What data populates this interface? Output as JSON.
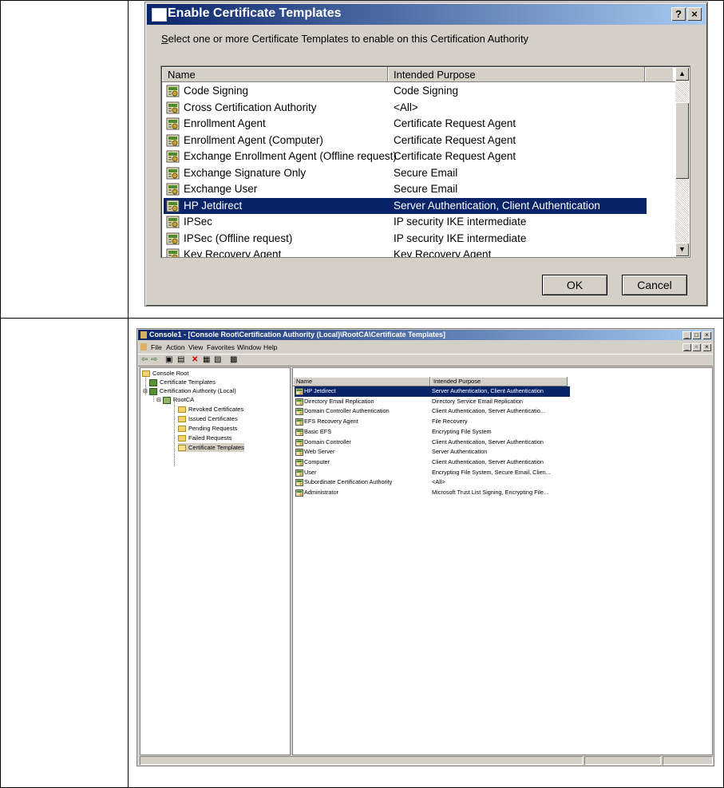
{
  "dialog": {
    "title": "Enable Certificate Templates",
    "help_button": "?",
    "close_button": "×",
    "instruction_ul": "S",
    "instruction_rest": "elect one or more Certificate Templates to enable on this Certification Authority",
    "columns": [
      "Name",
      "Intended Purpose"
    ],
    "rows": [
      {
        "name": "Code Signing",
        "purpose": "Code Signing"
      },
      {
        "name": "Cross Certification Authority",
        "purpose": "<All>"
      },
      {
        "name": "Enrollment Agent",
        "purpose": "Certificate Request Agent"
      },
      {
        "name": "Enrollment Agent (Computer)",
        "purpose": "Certificate Request Agent"
      },
      {
        "name": "Exchange Enrollment Agent (Offline request)",
        "purpose": "Certificate Request Agent"
      },
      {
        "name": "Exchange Signature Only",
        "purpose": "Secure Email"
      },
      {
        "name": "Exchange User",
        "purpose": "Secure Email"
      },
      {
        "name": "HP Jetdirect",
        "purpose": "Server Authentication, Client Authentication"
      },
      {
        "name": "IPSec",
        "purpose": "IP security IKE intermediate"
      },
      {
        "name": "IPSec (Offline request)",
        "purpose": "IP security IKE intermediate"
      },
      {
        "name": "Key Recovery Agent",
        "purpose": "Key Recovery Agent"
      }
    ],
    "selected_row": "HP Jetdirect",
    "ok_label": "OK",
    "cancel_label": "Cancel"
  },
  "console": {
    "title": "Console1 - [Console Root\\Certification Authority (Local)\\RootCA\\Certificate Templates]",
    "menu": [
      "File",
      "Action",
      "View",
      "Favorites",
      "Window",
      "Help"
    ],
    "tree": {
      "root": "Console Root",
      "templates": "Certificate Templates",
      "ca": "Certification Authority (Local)",
      "rootca": "RootCA",
      "revoked": "Revoked Certificates",
      "issued": "Issued Certificates",
      "pending": "Pending Requests",
      "failed": "Failed Requests",
      "cert_templates": "Certificate Templates"
    },
    "columns": [
      "Name",
      "Intended Purpose"
    ],
    "rows": [
      {
        "name": "HP Jetdirect",
        "purpose": "Server Authentication, Client Authentication"
      },
      {
        "name": "Directory Email Replication",
        "purpose": "Directory Service Email Replication"
      },
      {
        "name": "Domain Controller Authentication",
        "purpose": "Client Authentication, Server Authenticatio..."
      },
      {
        "name": "EFS Recovery Agent",
        "purpose": "File Recovery"
      },
      {
        "name": "Basic EFS",
        "purpose": "Encrypting File System"
      },
      {
        "name": "Domain Controller",
        "purpose": "Client Authentication, Server Authentication"
      },
      {
        "name": "Web Server",
        "purpose": "Server Authentication"
      },
      {
        "name": "Computer",
        "purpose": "Client Authentication, Server Authentication"
      },
      {
        "name": "User",
        "purpose": "Encrypting File System, Secure Email, Clien..."
      },
      {
        "name": "Subordinate Certification Authority",
        "purpose": "<All>"
      },
      {
        "name": "Administrator",
        "purpose": "Microsoft Trust List Signing, Encrypting File..."
      }
    ],
    "selected_row": "HP Jetdirect"
  },
  "colors": {
    "title_bar": "#0a246a",
    "selection": "#0a246a",
    "face": "#d4d0c8"
  }
}
